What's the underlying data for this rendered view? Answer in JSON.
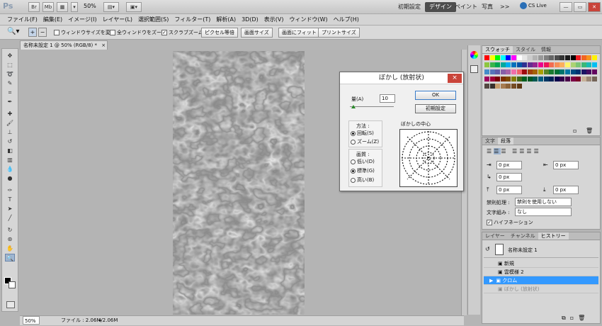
{
  "appbar": {
    "logo": "Ps",
    "zoom": "50%",
    "workspaces": [
      "初期設定",
      "デザイン",
      "ペイント",
      "写真"
    ],
    "active_workspace": "デザイン",
    "more": ">>",
    "cslive": "CS Live"
  },
  "menu": [
    "ファイル(F)",
    "編集(E)",
    "イメージ(I)",
    "レイヤー(L)",
    "選択範囲(S)",
    "フィルター(T)",
    "解析(A)",
    "3D(D)",
    "表示(V)",
    "ウィンドウ(W)",
    "ヘルプ(H)"
  ],
  "options": {
    "resize_windows": "ウィンドウサイズを変更",
    "zoom_all": "全ウィンドウをズーム",
    "scrubby_zoom": "スクラブズーム",
    "actual_pixels": "ピクセル等倍",
    "fit_screen": "画面サイズ",
    "fill_screen": "画面にフィット",
    "print_size": "プリントサイズ"
  },
  "document": {
    "tab_title": "名称未設定 1 @ 50% (RGB/8) *",
    "close": "×",
    "zoom": "50%",
    "file_info": "ファイル : 2.06M/2.06M"
  },
  "dialog": {
    "title": "ぼかし (放射状)",
    "amount_label": "量(A)",
    "amount_value": "10",
    "ok": "OK",
    "reset": "初期設定",
    "method_label": "方法 :",
    "method_spin": "回転(S)",
    "method_zoom": "ズーム(Z)",
    "quality_label": "画質 :",
    "quality_draft": "低い(D)",
    "quality_good": "標準(G)",
    "quality_best": "高い(B)",
    "center_label": "ぼかしの中心",
    "close": "×"
  },
  "swatches_panel": {
    "tabs": [
      "スウォッチ",
      "スタイル",
      "情報"
    ],
    "active_tab": "スウォッチ"
  },
  "paragraph_panel": {
    "tabs": [
      "文字",
      "段落"
    ],
    "active_tab": "段落",
    "indent_left": "0 px",
    "indent_right": "0 px",
    "indent_first": "0 px",
    "space_before": "0 px",
    "space_after": "0 px",
    "kinsoku_label": "禁則処理 :",
    "kinsoku_value": "禁則を使用しない",
    "mojikumi_label": "文字組み :",
    "mojikumi_value": "なし",
    "hyphenate": "ハイフネーション"
  },
  "history_panel": {
    "tabs": [
      "レイヤー",
      "チャンネル",
      "ヒストリー"
    ],
    "active_tab": "ヒストリー",
    "snapshot": "名称未設定 1",
    "items": [
      "新規",
      "雲模様 2",
      "クロム",
      "ぼかし (放射状)"
    ],
    "selected_index": 2
  },
  "colors": {
    "accent": "#3399ff",
    "workspace_active": "#4d4d4d",
    "dialog_close": "#c9443a"
  }
}
